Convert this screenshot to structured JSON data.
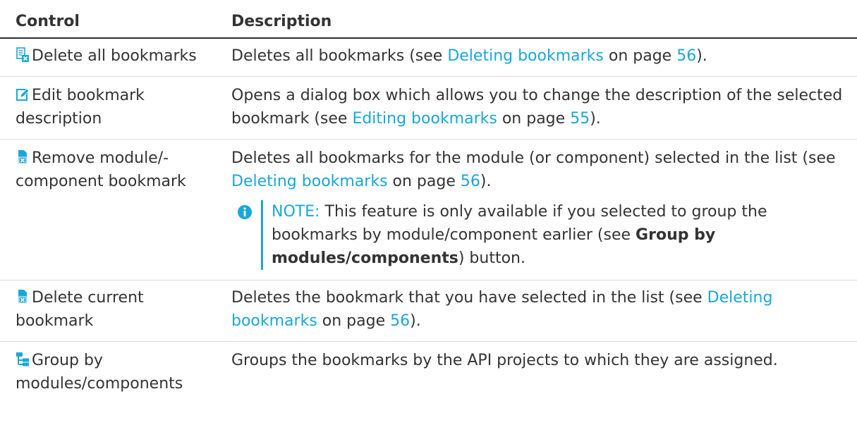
{
  "table": {
    "headers": {
      "control": "Control",
      "description": "Description"
    },
    "rows": [
      {
        "control_label": "Delete all bookmarks",
        "icon": "delete-all-bookmarks-icon",
        "desc_before": "Deletes all bookmarks (see ",
        "link_text": "Deleting bookmarks",
        "desc_middle": " on page ",
        "page": "56",
        "desc_after": ")."
      },
      {
        "control_label": "Edit bookmark description",
        "icon": "edit-pencil-icon",
        "desc_before": "Opens a dialog box which allows you to change the description of the selected bookmark (see ",
        "link_text": "Editing bookmarks",
        "desc_middle": " on page ",
        "page": "55",
        "desc_after": ")."
      },
      {
        "control_label": "Remove module/-component bookmark",
        "icon": "remove-bookmark-icon",
        "desc_before": "Deletes all bookmarks for the module (or component) selected in the list (see ",
        "link_text": "Deleting bookmarks",
        "desc_middle": " on page ",
        "page": "56",
        "desc_after": ").",
        "note": {
          "label": "NOTE:",
          "text_before": " This feature is only available if you selected to group the bookmarks by module/component earlier (see ",
          "bold": "Group by modules/components",
          "text_after": ") button."
        }
      },
      {
        "control_label": "Delete current bookmark",
        "icon": "delete-bookmark-icon",
        "desc_before": "Deletes the bookmark that you have selected in the list (see ",
        "link_text": "Deleting bookmarks",
        "desc_middle": " on page ",
        "page": "56",
        "desc_after": ")."
      },
      {
        "control_label": "Group by modules/components",
        "icon": "group-hierarchy-icon",
        "desc_text": "Groups the bookmarks by the API projects to which they are assigned."
      }
    ]
  },
  "colors": {
    "link": "#1aa7d8",
    "text": "#333333",
    "header_rule": "#2f2f2f"
  }
}
